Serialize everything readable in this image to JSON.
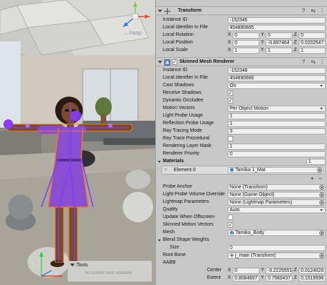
{
  "scene": {
    "persp_label": "←Persp",
    "tools": {
      "title": "Tools",
      "empty_message": "No custom tools available"
    },
    "gizmo": {
      "x_label": "x",
      "y_label": "y",
      "z_label": "z"
    }
  },
  "transform": {
    "title": "Transform",
    "fields": {
      "instance_id": {
        "label": "Instance ID",
        "value": "-152346"
      },
      "local_identifier": {
        "label": "Local Identfier In File",
        "value": "454890665"
      },
      "local_rotation": {
        "label": "Local Rotation",
        "x": "0",
        "y": "0",
        "z": "0"
      },
      "local_position": {
        "label": "Local Position",
        "x": "0",
        "y": "-0.897464",
        "z": "0.0202547"
      },
      "local_scale": {
        "label": "Local Scale",
        "x": "1",
        "y": "1",
        "z": "1"
      }
    }
  },
  "smr": {
    "title": "Skinned Mesh Renderer",
    "instance_id": {
      "label": "Instance ID",
      "value": "-152348"
    },
    "local_identifier": {
      "label": "Local Identfier In File",
      "value": "454890666"
    },
    "cast_shadows": {
      "label": "Cast Shadows",
      "value": "On"
    },
    "receive_shadows": {
      "label": "Receive Shadows",
      "checked": true
    },
    "dynamic_occludee": {
      "label": "Dynamic Occludee",
      "checked": true
    },
    "motion_vectors": {
      "label": "Motion Vectors",
      "value": "Per Object Motion"
    },
    "light_probe_usage": {
      "label": "Light Probe Usage",
      "value": "1"
    },
    "reflection_probe_usage": {
      "label": "Reflection Probe Usage",
      "value": "1"
    },
    "ray_tracing_mode": {
      "label": "Ray Tracing Mode",
      "value": "3"
    },
    "ray_trace_procedural": {
      "label": "Ray Trace Procedural",
      "checked": false
    },
    "rendering_layer_mask": {
      "label": "Rendering Layer Mask",
      "value": "1"
    },
    "renderer_priority": {
      "label": "Renderer Priority",
      "value": "0"
    },
    "materials": {
      "label": "Materials",
      "count": "1",
      "element_label": "Element 0",
      "element_value": "Tamika 1_Mat"
    },
    "probe_anchor": {
      "label": "Probe Anchor",
      "value": "None (Transform)"
    },
    "light_probe_volume_override": {
      "label": "Light Probe Volume Override",
      "value": "None (Game Object)"
    },
    "lightmap_parameters": {
      "label": "Lightmap Parameters",
      "value": "None (Lightmap Parameters)"
    },
    "quality": {
      "label": "Quality",
      "value": "Auto"
    },
    "update_when_offscreen": {
      "label": "Update When Offscreen",
      "checked": false
    },
    "skinned_motion_vectors": {
      "label": "Skinned Motion Vectors",
      "checked": true
    },
    "mesh": {
      "label": "Mesh",
      "value": "Tamika_Body"
    },
    "blend_shape_weights": {
      "label": "Blend Shape Weights",
      "size_label": "Size",
      "size_value": "0"
    },
    "root_bone": {
      "label": "Root Bone",
      "value": "j_main (Transform)"
    },
    "aabb": {
      "label": "AABB",
      "center": {
        "label": "Center",
        "x": "0",
        "y": "-0.2225551",
        "z": "0.0124028"
      },
      "extent": {
        "label": "Extent",
        "x": "0.8084697",
        "y": "0.7560437",
        "z": "0.1519596"
      }
    }
  },
  "colors": {
    "inspector_bg": "#c8c8c8",
    "field_bg": "#f0f0f0",
    "selection_orange": "#f07a1a",
    "bone_purple": "#7a3cff",
    "dress_purple": "#8a4fd0"
  }
}
